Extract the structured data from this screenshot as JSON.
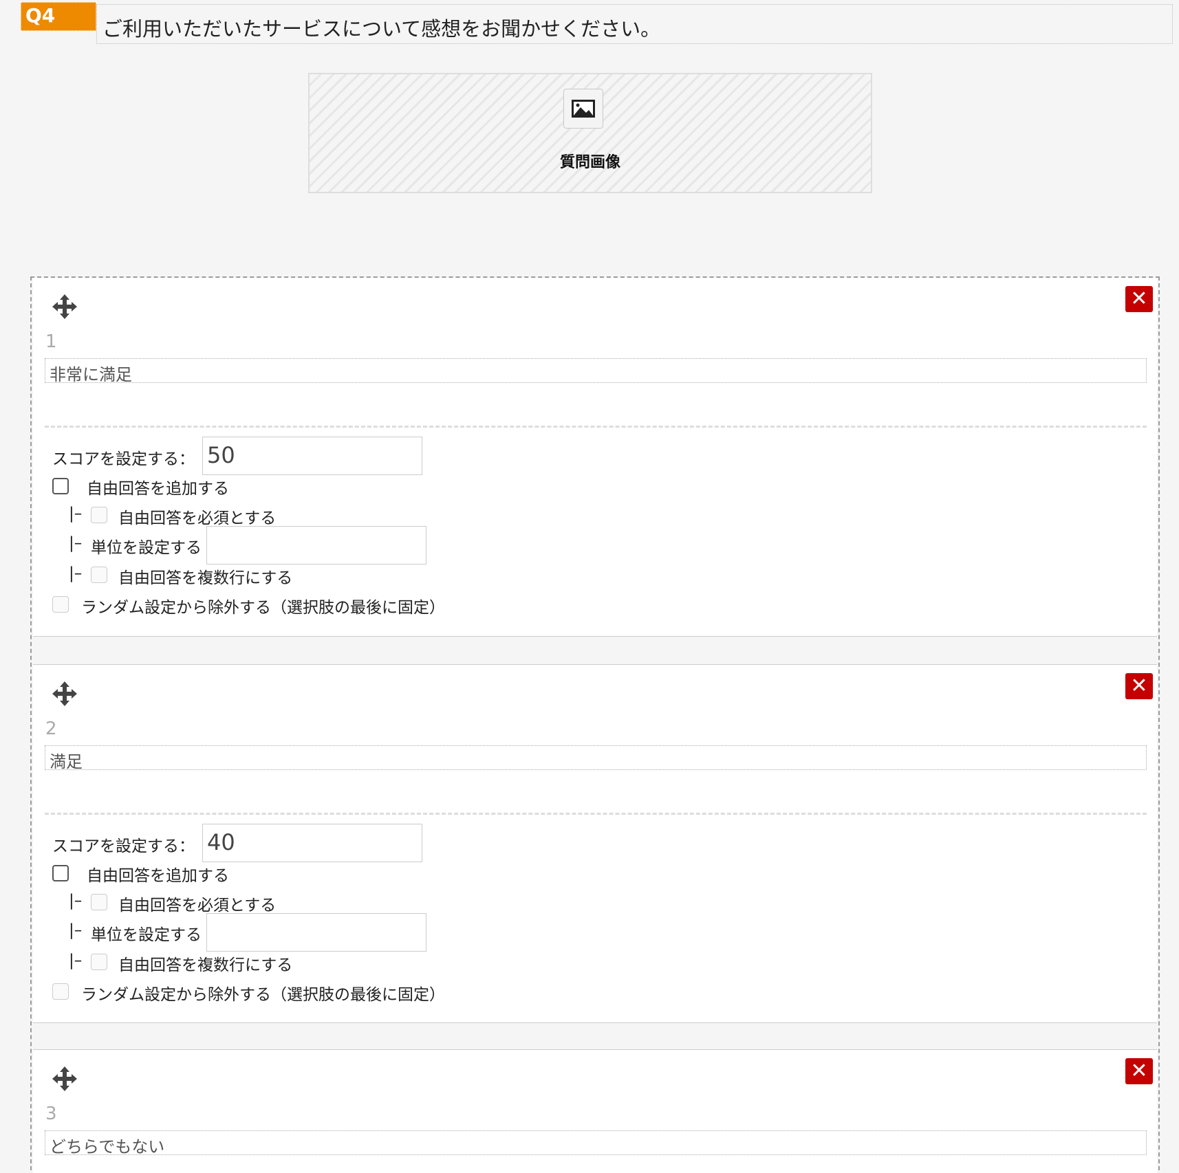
{
  "question": {
    "badge": "Q4",
    "title": "ご利用いただいたサービスについて感想をお聞かせください。"
  },
  "image_box": {
    "label": "質問画像"
  },
  "choice_labels": {
    "score": "スコアを設定する：",
    "add_free": "自由回答を追加する",
    "free_required": "自由回答を必須とする",
    "unit": "単位を設定する",
    "multiline": "自由回答を複数行にする",
    "exclude_random": "ランダム設定から除外する（選択肢の最後に固定）",
    "branch": "|–"
  },
  "choices": [
    {
      "number": "1",
      "text": "非常に満足",
      "score": "50"
    },
    {
      "number": "2",
      "text": "満足",
      "score": "40"
    },
    {
      "number": "3",
      "text": "どちらでもない"
    }
  ]
}
